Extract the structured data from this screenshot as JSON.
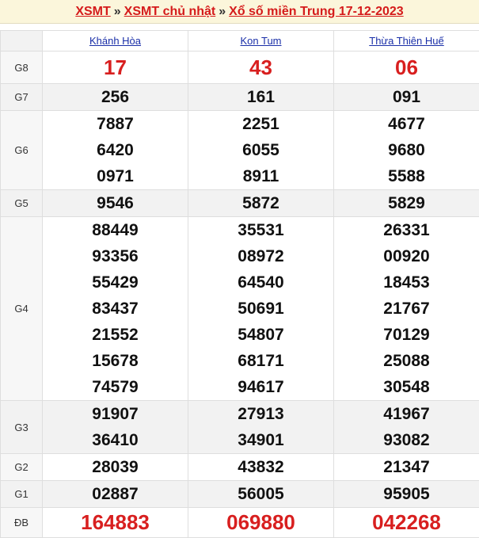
{
  "breadcrumb": {
    "link1": "XSMT",
    "link2": "XSMT chủ nhật",
    "link3": "Xổ số miền Trung 17-12-2023",
    "separator": "»"
  },
  "provinces": [
    "Khánh Hòa",
    "Kon Tum",
    "Thừa Thiên Huế"
  ],
  "prizes": [
    {
      "label": "G8",
      "values": [
        [
          "17"
        ],
        [
          "43"
        ],
        [
          "06"
        ]
      ]
    },
    {
      "label": "G7",
      "values": [
        [
          "256"
        ],
        [
          "161"
        ],
        [
          "091"
        ]
      ]
    },
    {
      "label": "G6",
      "values": [
        [
          "7887",
          "6420",
          "0971"
        ],
        [
          "2251",
          "6055",
          "8911"
        ],
        [
          "4677",
          "9680",
          "5588"
        ]
      ]
    },
    {
      "label": "G5",
      "values": [
        [
          "9546"
        ],
        [
          "5872"
        ],
        [
          "5829"
        ]
      ]
    },
    {
      "label": "G4",
      "values": [
        [
          "88449",
          "93356",
          "55429",
          "83437",
          "21552",
          "15678",
          "74579"
        ],
        [
          "35531",
          "08972",
          "64540",
          "50691",
          "54807",
          "68171",
          "94617"
        ],
        [
          "26331",
          "00920",
          "18453",
          "21767",
          "70129",
          "25088",
          "30548"
        ]
      ]
    },
    {
      "label": "G3",
      "values": [
        [
          "91907",
          "36410"
        ],
        [
          "27913",
          "34901"
        ],
        [
          "41967",
          "93082"
        ]
      ]
    },
    {
      "label": "G2",
      "values": [
        [
          "28039"
        ],
        [
          "43832"
        ],
        [
          "21347"
        ]
      ]
    },
    {
      "label": "G1",
      "values": [
        [
          "02887"
        ],
        [
          "56005"
        ],
        [
          "95905"
        ]
      ]
    },
    {
      "label": "ĐB",
      "values": [
        [
          "164883"
        ],
        [
          "069880"
        ],
        [
          "042268"
        ]
      ]
    }
  ]
}
